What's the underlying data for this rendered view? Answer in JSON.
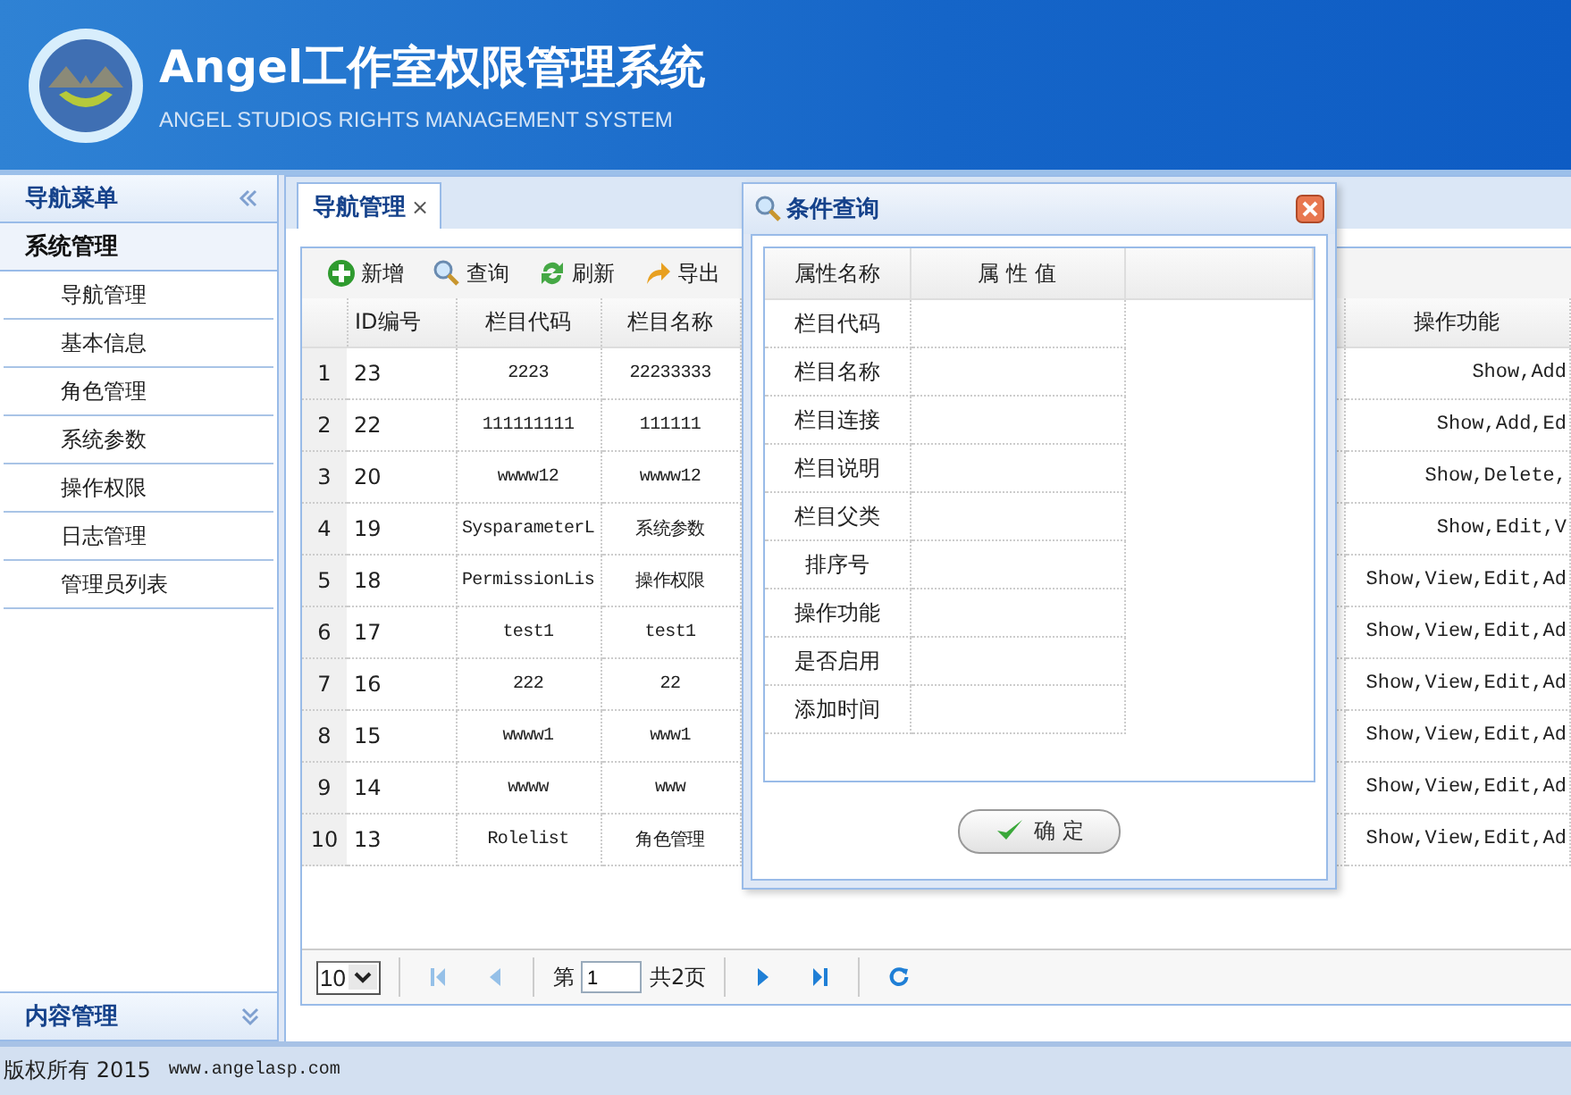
{
  "header": {
    "title": "Angel工作室权限管理系统",
    "subtitle": "ANGEL STUDIOS RIGHTS MANAGEMENT SYSTEM"
  },
  "sidebar": {
    "title": "导航菜单",
    "groups": [
      {
        "label": "系统管理",
        "expanded": true,
        "items": [
          {
            "label": "导航管理"
          },
          {
            "label": "基本信息"
          },
          {
            "label": "角色管理"
          },
          {
            "label": "系统参数"
          },
          {
            "label": "操作权限"
          },
          {
            "label": "日志管理"
          },
          {
            "label": "管理员列表"
          }
        ]
      },
      {
        "label": "内容管理",
        "expanded": false
      }
    ]
  },
  "tabs": [
    {
      "label": "导航管理",
      "selected": true,
      "close": "×"
    }
  ],
  "toolbar": [
    {
      "label": "新增",
      "kind": "add"
    },
    {
      "label": "查询",
      "kind": "search"
    },
    {
      "label": "刷新",
      "kind": "refresh"
    },
    {
      "label": "导出",
      "kind": "export"
    }
  ],
  "table": {
    "columns": [
      {
        "label": "ID编号"
      },
      {
        "label": "栏目代码"
      },
      {
        "label": "栏目名称"
      },
      {
        "label": "操作功能"
      }
    ],
    "rows": [
      {
        "number": "1",
        "cells": [
          "23",
          "2223",
          "22233333",
          "Show,Add"
        ]
      },
      {
        "number": "2",
        "cells": [
          "22",
          "111111111",
          "111111",
          "Show,Add,Ed"
        ]
      },
      {
        "number": "3",
        "cells": [
          "20",
          "wwww12",
          "wwww12",
          "Show,Delete,"
        ]
      },
      {
        "number": "4",
        "cells": [
          "19",
          "SysparameterL",
          "系统参数",
          "Show,Edit,V"
        ]
      },
      {
        "number": "5",
        "cells": [
          "18",
          "PermissionLis",
          "操作权限",
          "Show,View,Edit,Ad"
        ]
      },
      {
        "number": "6",
        "cells": [
          "17",
          "test1",
          "test1",
          "Show,View,Edit,Ad"
        ]
      },
      {
        "number": "7",
        "cells": [
          "16",
          "222",
          "22",
          "Show,View,Edit,Ad"
        ]
      },
      {
        "number": "8",
        "cells": [
          "15",
          "wwww1",
          "www1",
          "Show,View,Edit,Ad"
        ]
      },
      {
        "number": "9",
        "cells": [
          "14",
          "wwww",
          "www",
          "Show,View,Edit,Ad"
        ]
      },
      {
        "number": "10",
        "cells": [
          "13",
          "Rolelist",
          "角色管理",
          "Show,View,Edit,Ad"
        ]
      }
    ]
  },
  "pager": {
    "page_size": "10",
    "page_label": "第",
    "page": "1",
    "total": "共2页",
    "buttons": [
      {
        "kind": "first",
        "disabled": true
      },
      {
        "kind": "prev",
        "disabled": true
      },
      {
        "kind": "next",
        "disabled": false
      },
      {
        "kind": "last",
        "disabled": false
      },
      {
        "kind": "reload",
        "disabled": false
      }
    ]
  },
  "dialog": {
    "title": "条件查询",
    "columns": [
      {
        "label": "属性名称"
      },
      {
        "label": "属 性 值"
      }
    ],
    "fields": [
      "栏目代码",
      "栏目名称",
      "栏目连接",
      "栏目说明",
      "栏目父类",
      "排序号",
      "操作功能",
      "是否启用",
      "添加时间"
    ],
    "ok": "确 定"
  },
  "footer": {
    "copyright": "版权所有 2015",
    "url": "www.angelasp.com"
  }
}
